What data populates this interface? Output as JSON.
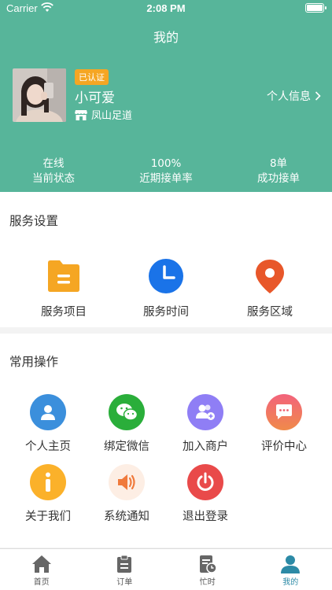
{
  "status": {
    "carrier": "Carrier",
    "time": "2:08 PM"
  },
  "nav": {
    "title": "我的"
  },
  "profile": {
    "badge": "已认证",
    "name": "小可爱",
    "shop": "凤山足道",
    "link_label": "个人信息"
  },
  "stats": [
    {
      "value": "在线",
      "label": "当前状态"
    },
    {
      "value": "100%",
      "label": "近期接单率"
    },
    {
      "value": "8单",
      "label": "成功接单"
    }
  ],
  "service": {
    "title": "服务设置",
    "items": [
      {
        "label": "服务项目",
        "icon": "folder-icon",
        "color": "#f5a623"
      },
      {
        "label": "服务时间",
        "icon": "clock-icon",
        "color": "#1a73e8"
      },
      {
        "label": "服务区域",
        "icon": "location-pin-icon",
        "color": "#e8572a"
      }
    ]
  },
  "operations": {
    "title": "常用操作",
    "items": [
      {
        "label": "个人主页",
        "icon": "user-icon",
        "color": "#3b8fdc"
      },
      {
        "label": "绑定微信",
        "icon": "wechat-icon",
        "color": "#2aae3a"
      },
      {
        "label": "加入商户",
        "icon": "users-add-icon",
        "color": "#8f7ef5"
      },
      {
        "label": "评价中心",
        "icon": "comment-icon",
        "color": "#ef5f6f"
      },
      {
        "label": "关于我们",
        "icon": "info-icon",
        "color": "#fbb12a"
      },
      {
        "label": "系统通知",
        "icon": "speaker-icon",
        "color": "#f07a3c"
      },
      {
        "label": "退出登录",
        "icon": "power-icon",
        "color": "#e94a4a"
      }
    ]
  },
  "tabbar": {
    "items": [
      {
        "label": "首页",
        "icon": "home-icon"
      },
      {
        "label": "订单",
        "icon": "clipboard-icon"
      },
      {
        "label": "忙时",
        "icon": "schedule-icon"
      },
      {
        "label": "我的",
        "icon": "profile-icon"
      }
    ],
    "active_color": "#2c8aa6"
  },
  "colors": {
    "header": "#57b59a",
    "badge": "#f5a623"
  }
}
